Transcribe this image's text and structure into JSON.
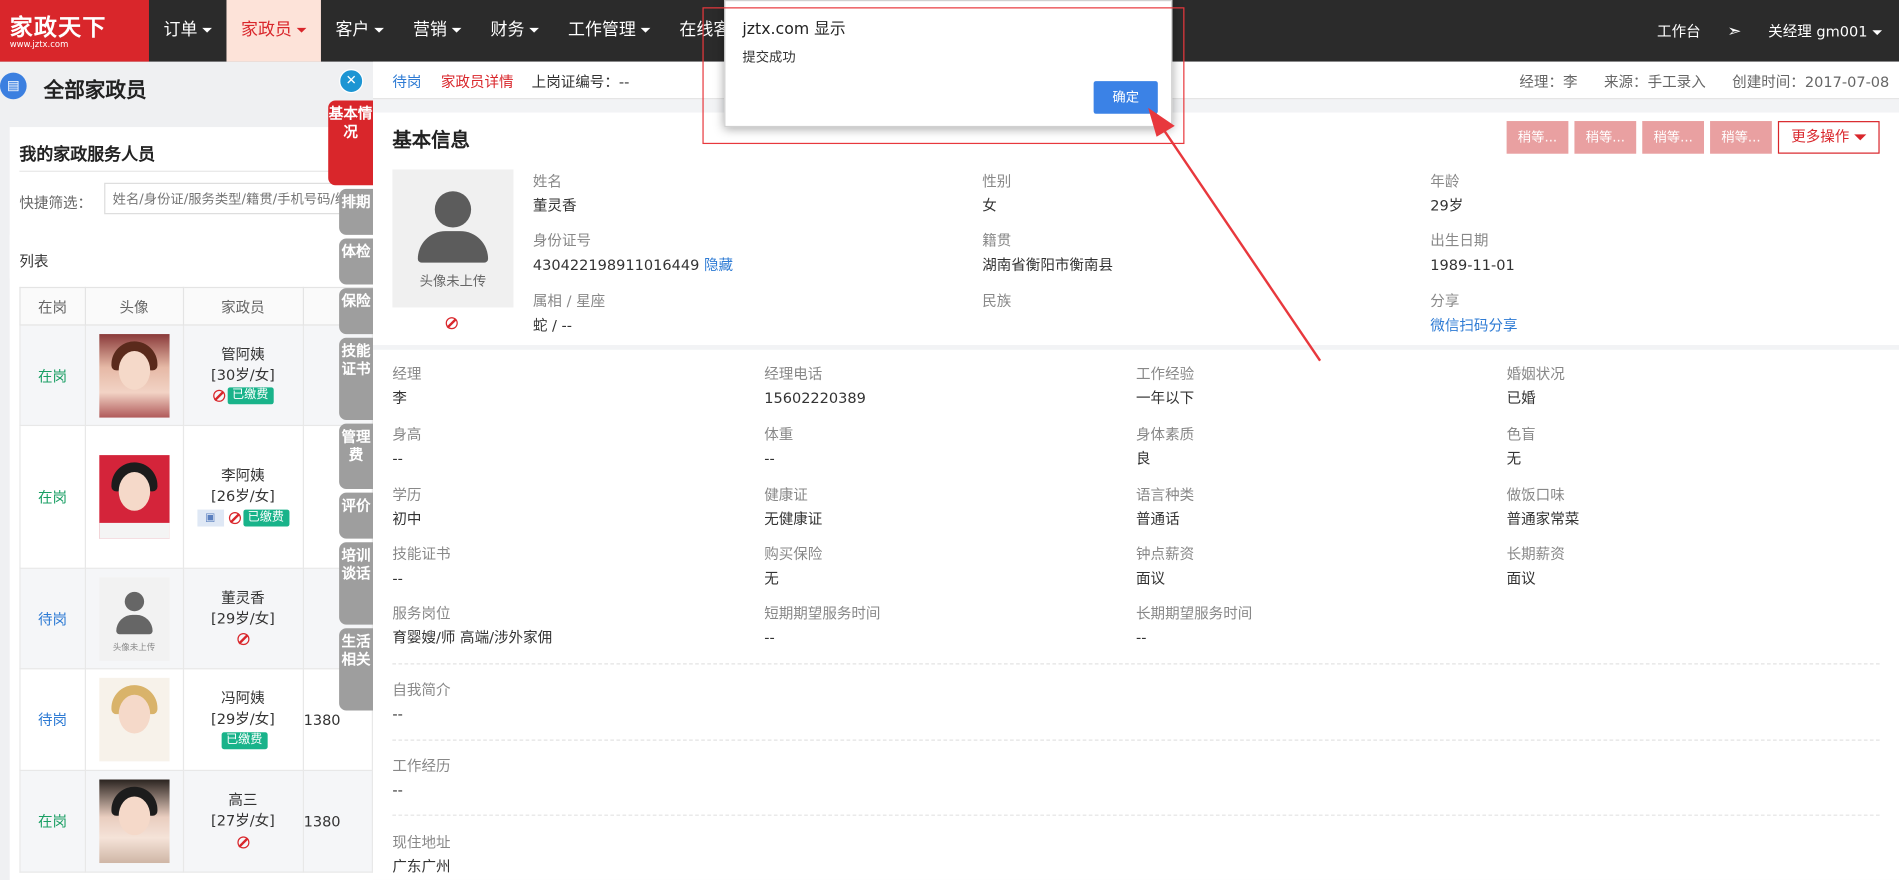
{
  "logo": {
    "name": "家政天下",
    "site": "www.jztx.com"
  },
  "nav": [
    {
      "label": "订单",
      "active": false
    },
    {
      "label": "家政员",
      "active": true
    },
    {
      "label": "客户",
      "active": false
    },
    {
      "label": "营销",
      "active": false
    },
    {
      "label": "财务",
      "active": false
    },
    {
      "label": "工作管理",
      "active": false
    },
    {
      "label": "在线客服",
      "active": false
    }
  ],
  "topright": {
    "workbench": "工作台",
    "user": "关经理 gm001"
  },
  "left": {
    "title": "全部家政员",
    "card_title": "我的家政服务人员",
    "filter_label": "快捷筛选：",
    "filter_placeholder": "姓名/身份证/服务类型/籍贯/手机号码/编号",
    "list_label": "列表",
    "columns": [
      "在岗",
      "头像",
      "家政员"
    ],
    "rows": [
      {
        "status": "在岗",
        "name": "管阿姨",
        "info": "[30岁/女]",
        "paid": "已缴费",
        "phone": ""
      },
      {
        "status": "在岗",
        "name": "李阿姨",
        "info": "[26岁/女]",
        "paid": "已缴费",
        "phone": ""
      },
      {
        "status": "待岗",
        "name": "董灵香",
        "info": "[29岁/女]",
        "paid": "",
        "phone": "",
        "avatar_caption": "头像未上传"
      },
      {
        "status": "待岗",
        "name": "冯阿姨",
        "info": "[29岁/女]",
        "paid": "已缴费",
        "phone": "1380"
      },
      {
        "status": "在岗",
        "name": "高三",
        "info": "[27岁/女]",
        "paid": "",
        "phone": "1380"
      }
    ]
  },
  "side_tabs": [
    "基本情况",
    "排期",
    "体检",
    "保险",
    "技能证书",
    "管理费",
    "评价",
    "培训谈话",
    "生活相关"
  ],
  "crumb": {
    "c1": "待岗",
    "c2": "家政员详情",
    "c3": "上岗证编号：--",
    "manager": "经理：李",
    "source": "来源：手工录入",
    "created": "创建时间：2017-07-08"
  },
  "basic": {
    "title": "基本信息",
    "action_buttons": [
      "稍等...",
      "稍等...",
      "稍等...",
      "稍等..."
    ],
    "more": "更多操作",
    "photo_caption": "头像未上传",
    "fields": [
      {
        "label": "姓名",
        "value": "董灵香"
      },
      {
        "label": "性别",
        "value": "女"
      },
      {
        "label": "年龄",
        "value": "29岁"
      },
      {
        "label": "身份证号",
        "value": "430422198911016449",
        "link": "隐藏"
      },
      {
        "label": "籍贯",
        "value": "湖南省衡阳市衡南县"
      },
      {
        "label": "出生日期",
        "value": "1989-11-01"
      },
      {
        "label": "属相 / 星座",
        "value": "蛇 / --"
      },
      {
        "label": "民族",
        "value": ""
      },
      {
        "label": "分享",
        "value": "",
        "link": "微信扫码分享"
      }
    ]
  },
  "details": [
    {
      "label": "经理",
      "value": "李"
    },
    {
      "label": "经理电话",
      "value": "15602220389"
    },
    {
      "label": "工作经验",
      "value": "一年以下"
    },
    {
      "label": "婚姻状况",
      "value": "已婚"
    },
    {
      "label": "身高",
      "value": "--"
    },
    {
      "label": "体重",
      "value": "--"
    },
    {
      "label": "身体素质",
      "value": "良"
    },
    {
      "label": "色盲",
      "value": "无"
    },
    {
      "label": "学历",
      "value": "初中"
    },
    {
      "label": "健康证",
      "value": "无健康证"
    },
    {
      "label": "语言种类",
      "value": "普通话"
    },
    {
      "label": "做饭口味",
      "value": "普通家常菜"
    },
    {
      "label": "技能证书",
      "value": "--"
    },
    {
      "label": "购买保险",
      "value": "无"
    },
    {
      "label": "钟点薪资",
      "value": "面议"
    },
    {
      "label": "长期薪资",
      "value": "面议"
    },
    {
      "label": "服务岗位",
      "value": "育婴嫂/师 高端/涉外家佣"
    },
    {
      "label": "短期期望服务时间",
      "value": "--"
    },
    {
      "label": "长期期望服务时间",
      "value": "--"
    }
  ],
  "long_fields": [
    {
      "label": "自我简介",
      "value": "--"
    },
    {
      "label": "工作经历",
      "value": "--"
    },
    {
      "label": "现住地址",
      "value": "广东广州"
    }
  ],
  "dialog": {
    "title": "jztx.com 显示",
    "message": "提交成功",
    "ok": "确定"
  },
  "colors": {
    "brand": "#d9262b",
    "topbar": "#2b2b2b",
    "link": "#2e7bd4",
    "paid": "#19b38a",
    "dialog_button": "#3b82e6",
    "annotation": "#e8383d"
  }
}
